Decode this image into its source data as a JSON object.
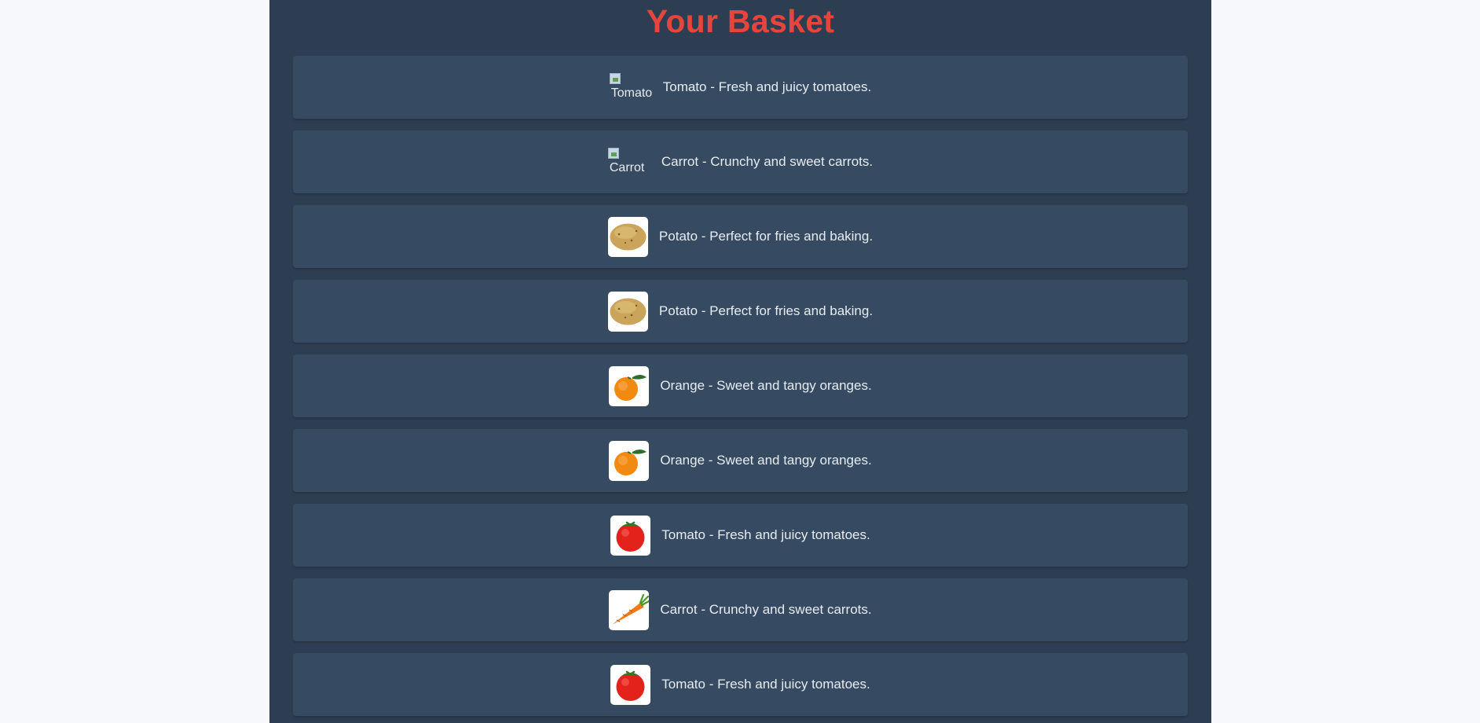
{
  "basket": {
    "title": "Your Basket",
    "items": [
      {
        "icon": "tomato-icon",
        "image_loaded": false,
        "alt": "Tomato",
        "text": "Tomato - Fresh and juicy tomatoes."
      },
      {
        "icon": "carrot-icon",
        "image_loaded": false,
        "alt": "Carrot",
        "text": "Carrot - Crunchy and sweet carrots."
      },
      {
        "icon": "potato-icon",
        "image_loaded": true,
        "alt": "Potato",
        "text": "Potato - Perfect for fries and baking."
      },
      {
        "icon": "potato-icon",
        "image_loaded": true,
        "alt": "Potato",
        "text": "Potato - Perfect for fries and baking."
      },
      {
        "icon": "orange-icon",
        "image_loaded": true,
        "alt": "Orange",
        "text": "Orange - Sweet and tangy oranges."
      },
      {
        "icon": "orange-icon",
        "image_loaded": true,
        "alt": "Orange",
        "text": "Orange - Sweet and tangy oranges."
      },
      {
        "icon": "tomato-icon",
        "image_loaded": true,
        "alt": "Tomato",
        "text": "Tomato - Fresh and juicy tomatoes."
      },
      {
        "icon": "carrot-icon",
        "image_loaded": true,
        "alt": "Carrot",
        "text": "Carrot - Crunchy and sweet carrots."
      },
      {
        "icon": "tomato-icon",
        "image_loaded": true,
        "alt": "Tomato",
        "text": "Tomato - Fresh and juicy tomatoes."
      }
    ]
  },
  "colors": {
    "page_bg": "#f6f8fb",
    "panel_bg": "#2e3e52",
    "card_bg": "#364b61",
    "title": "#e6453b",
    "text": "#e6ecf2"
  }
}
